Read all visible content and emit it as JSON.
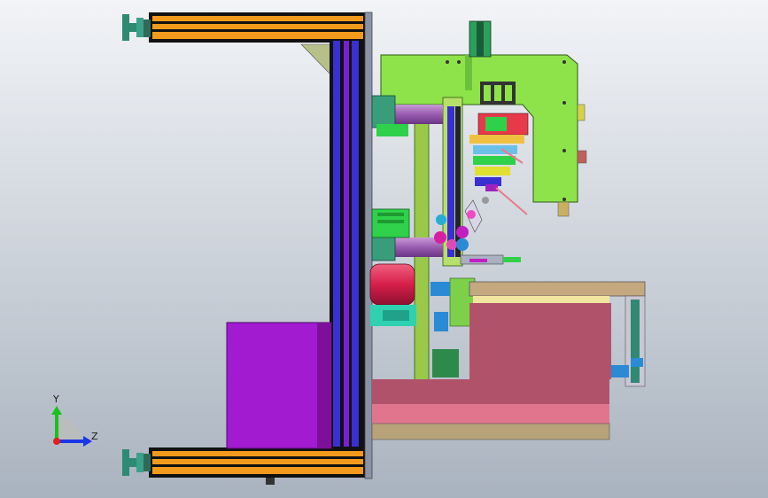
{
  "view": {
    "background_top": "#f2f4f7",
    "background_bottom": "#a9b3bf"
  },
  "colors": {
    "frame_orange": "#f39a1c",
    "frame_black": "#111111",
    "column_blue": "#3a2fd1",
    "column_purple": "#7a1fd6",
    "plate_gray": "#8a93a6",
    "bracket_green": "#8fe34a",
    "tank_red": "#d61f4a",
    "box_magenta": "#a21bd1",
    "table_rose": "#b0536a",
    "table_pink": "#e2758e",
    "motor_green": "#2fd14a",
    "rail_lilac": "#b77ac7",
    "stand_teal": "#2e8a73"
  },
  "triad": {
    "y_label": "Y",
    "z_label": "Z",
    "y_color": "#19c21c",
    "z_color": "#1a36e6",
    "x_color": "#e0201a"
  }
}
